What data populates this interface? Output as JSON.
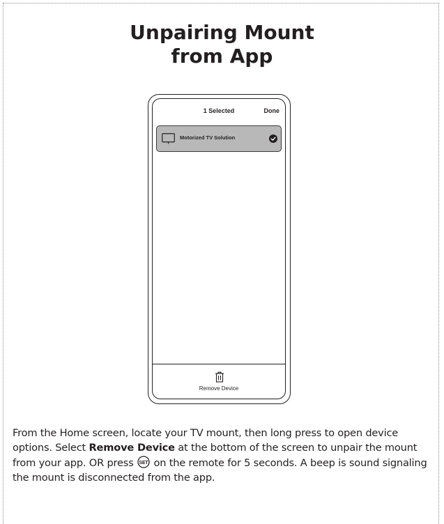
{
  "title": {
    "line1": "Unpairing Mount",
    "line2": "from App"
  },
  "phone": {
    "header_title": "1 Selected",
    "done_label": "Done",
    "device": {
      "icon": "tv-icon",
      "name": "Motorized TV Solution",
      "selected_icon": "checkmark-circle-icon"
    },
    "remove_icon": "trash-icon",
    "remove_label": "Remove Device"
  },
  "instructions": {
    "part1": "From the Home screen, locate your TV mount, then long press to open device options. Select ",
    "bold_term": "Remove Device",
    "part2": " at the bottom of the screen to unpair the mount from your app.  OR press ",
    "set_button_icon": "set-button-icon",
    "set_button_label": "SET",
    "part3": " on the remote for 5 seconds. A beep is sound signaling the mount is disconnected from the app."
  }
}
